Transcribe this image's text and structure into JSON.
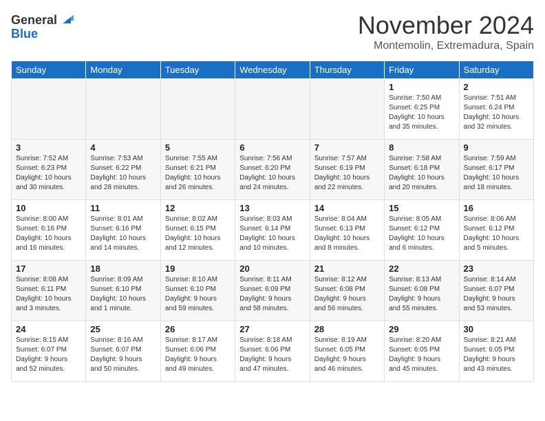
{
  "header": {
    "logo_general": "General",
    "logo_blue": "Blue",
    "month_title": "November 2024",
    "location": "Montemolin, Extremadura, Spain"
  },
  "days_of_week": [
    "Sunday",
    "Monday",
    "Tuesday",
    "Wednesday",
    "Thursday",
    "Friday",
    "Saturday"
  ],
  "weeks": [
    [
      {
        "day": "",
        "info": "",
        "empty": true
      },
      {
        "day": "",
        "info": "",
        "empty": true
      },
      {
        "day": "",
        "info": "",
        "empty": true
      },
      {
        "day": "",
        "info": "",
        "empty": true
      },
      {
        "day": "",
        "info": "",
        "empty": true
      },
      {
        "day": "1",
        "info": "Sunrise: 7:50 AM\nSunset: 6:25 PM\nDaylight: 10 hours\nand 35 minutes."
      },
      {
        "day": "2",
        "info": "Sunrise: 7:51 AM\nSunset: 6:24 PM\nDaylight: 10 hours\nand 32 minutes."
      }
    ],
    [
      {
        "day": "3",
        "info": "Sunrise: 7:52 AM\nSunset: 6:23 PM\nDaylight: 10 hours\nand 30 minutes."
      },
      {
        "day": "4",
        "info": "Sunrise: 7:53 AM\nSunset: 6:22 PM\nDaylight: 10 hours\nand 28 minutes."
      },
      {
        "day": "5",
        "info": "Sunrise: 7:55 AM\nSunset: 6:21 PM\nDaylight: 10 hours\nand 26 minutes."
      },
      {
        "day": "6",
        "info": "Sunrise: 7:56 AM\nSunset: 6:20 PM\nDaylight: 10 hours\nand 24 minutes."
      },
      {
        "day": "7",
        "info": "Sunrise: 7:57 AM\nSunset: 6:19 PM\nDaylight: 10 hours\nand 22 minutes."
      },
      {
        "day": "8",
        "info": "Sunrise: 7:58 AM\nSunset: 6:18 PM\nDaylight: 10 hours\nand 20 minutes."
      },
      {
        "day": "9",
        "info": "Sunrise: 7:59 AM\nSunset: 6:17 PM\nDaylight: 10 hours\nand 18 minutes."
      }
    ],
    [
      {
        "day": "10",
        "info": "Sunrise: 8:00 AM\nSunset: 6:16 PM\nDaylight: 10 hours\nand 16 minutes."
      },
      {
        "day": "11",
        "info": "Sunrise: 8:01 AM\nSunset: 6:16 PM\nDaylight: 10 hours\nand 14 minutes."
      },
      {
        "day": "12",
        "info": "Sunrise: 8:02 AM\nSunset: 6:15 PM\nDaylight: 10 hours\nand 12 minutes."
      },
      {
        "day": "13",
        "info": "Sunrise: 8:03 AM\nSunset: 6:14 PM\nDaylight: 10 hours\nand 10 minutes."
      },
      {
        "day": "14",
        "info": "Sunrise: 8:04 AM\nSunset: 6:13 PM\nDaylight: 10 hours\nand 8 minutes."
      },
      {
        "day": "15",
        "info": "Sunrise: 8:05 AM\nSunset: 6:12 PM\nDaylight: 10 hours\nand 6 minutes."
      },
      {
        "day": "16",
        "info": "Sunrise: 8:06 AM\nSunset: 6:12 PM\nDaylight: 10 hours\nand 5 minutes."
      }
    ],
    [
      {
        "day": "17",
        "info": "Sunrise: 8:08 AM\nSunset: 6:11 PM\nDaylight: 10 hours\nand 3 minutes."
      },
      {
        "day": "18",
        "info": "Sunrise: 8:09 AM\nSunset: 6:10 PM\nDaylight: 10 hours\nand 1 minute."
      },
      {
        "day": "19",
        "info": "Sunrise: 8:10 AM\nSunset: 6:10 PM\nDaylight: 9 hours\nand 59 minutes."
      },
      {
        "day": "20",
        "info": "Sunrise: 8:11 AM\nSunset: 6:09 PM\nDaylight: 9 hours\nand 58 minutes."
      },
      {
        "day": "21",
        "info": "Sunrise: 8:12 AM\nSunset: 6:08 PM\nDaylight: 9 hours\nand 56 minutes."
      },
      {
        "day": "22",
        "info": "Sunrise: 8:13 AM\nSunset: 6:08 PM\nDaylight: 9 hours\nand 55 minutes."
      },
      {
        "day": "23",
        "info": "Sunrise: 8:14 AM\nSunset: 6:07 PM\nDaylight: 9 hours\nand 53 minutes."
      }
    ],
    [
      {
        "day": "24",
        "info": "Sunrise: 8:15 AM\nSunset: 6:07 PM\nDaylight: 9 hours\nand 52 minutes."
      },
      {
        "day": "25",
        "info": "Sunrise: 8:16 AM\nSunset: 6:07 PM\nDaylight: 9 hours\nand 50 minutes."
      },
      {
        "day": "26",
        "info": "Sunrise: 8:17 AM\nSunset: 6:06 PM\nDaylight: 9 hours\nand 49 minutes."
      },
      {
        "day": "27",
        "info": "Sunrise: 8:18 AM\nSunset: 6:06 PM\nDaylight: 9 hours\nand 47 minutes."
      },
      {
        "day": "28",
        "info": "Sunrise: 8:19 AM\nSunset: 6:05 PM\nDaylight: 9 hours\nand 46 minutes."
      },
      {
        "day": "29",
        "info": "Sunrise: 8:20 AM\nSunset: 6:05 PM\nDaylight: 9 hours\nand 45 minutes."
      },
      {
        "day": "30",
        "info": "Sunrise: 8:21 AM\nSunset: 6:05 PM\nDaylight: 9 hours\nand 43 minutes."
      }
    ]
  ]
}
